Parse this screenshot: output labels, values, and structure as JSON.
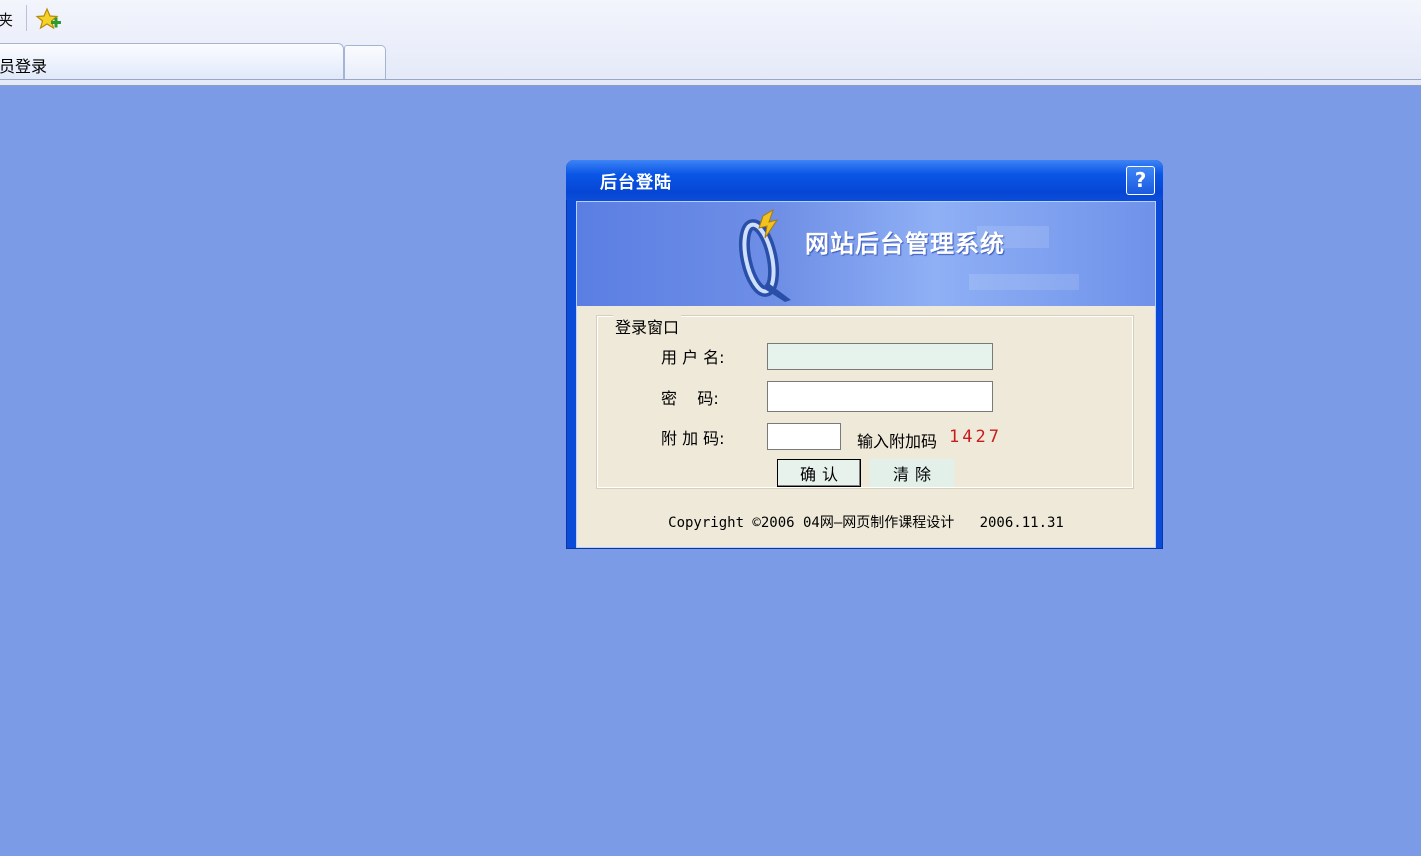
{
  "browser": {
    "favorites_label": "夹",
    "star_icon": "favorites-star-icon",
    "tab_title": "员登录",
    "new_tab_label": ""
  },
  "window": {
    "title": "后台登陆",
    "help_label": "?",
    "banner_title": "网站后台管理系统"
  },
  "form": {
    "legend": "登录窗口",
    "username_label": "用 户 名:",
    "password_label": "密    码:",
    "code_label": "附 加 码:",
    "username_value": "",
    "password_value": "",
    "code_value": "",
    "code_hint": "输入附加码",
    "code_value_shown": "1427",
    "confirm_label": "确认",
    "clear_label": "清除"
  },
  "footer": {
    "copyright": "Copyright ©2006 04网—网页制作课程设计   2006.11.31"
  },
  "colors": {
    "page_background": "#7b9be6",
    "window_title_blue": "#0b56e6",
    "form_background": "#efe9d9",
    "code_red": "#c81c1c"
  }
}
